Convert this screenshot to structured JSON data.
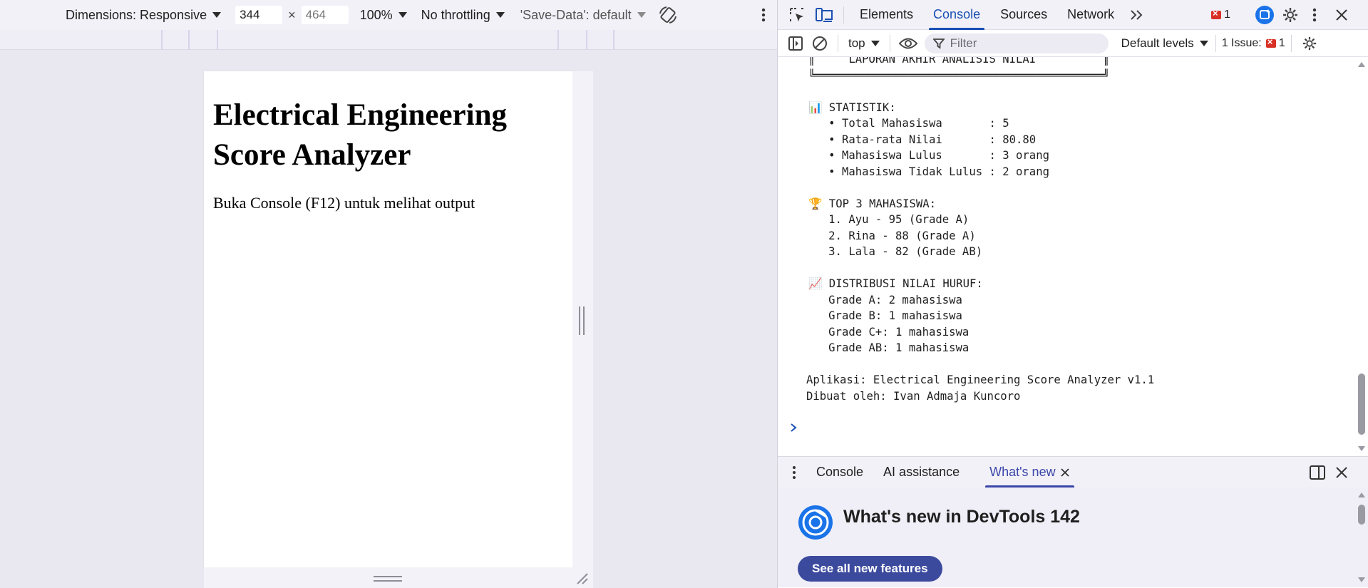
{
  "device_toolbar": {
    "dimensions_label": "Dimensions: Responsive",
    "width_value": "344",
    "height_placeholder": "464",
    "times": "×",
    "zoom": "100%",
    "throttling": "No throttling",
    "save_data": "'Save-Data': default"
  },
  "page": {
    "heading": "Electrical Engineering Score Analyzer",
    "text": "Buka Console (F12) untuk melihat output"
  },
  "devtools": {
    "tabs": [
      "Elements",
      "Console",
      "Sources",
      "Network"
    ],
    "active_tab": "Console",
    "error_count": "1",
    "console_toolbar": {
      "context": "top",
      "filter_placeholder": "Filter",
      "levels": "Default levels",
      "issues_label": "1 Issue:",
      "issues_count": "1"
    },
    "console_lines": [
      "║     LAPORAN AKHIR ANALISIS NILAI          ║",
      "╚═══════════════════════════════════════════╝",
      "",
      "📊 STATISTIK:",
      "   • Total Mahasiswa       : 5",
      "   • Rata-rata Nilai       : 80.80",
      "   • Mahasiswa Lulus       : 3 orang",
      "   • Mahasiswa Tidak Lulus : 2 orang",
      "",
      "🏆 TOP 3 MAHASISWA:",
      "   1. Ayu - 95 (Grade A)",
      "   2. Rina - 88 (Grade A)",
      "   3. Lala - 82 (Grade AB)",
      "",
      "📈 DISTRIBUSI NILAI HURUF:",
      "   Grade A: 2 mahasiswa",
      "   Grade B: 1 mahasiswa",
      "   Grade C+: 1 mahasiswa",
      "   Grade AB: 1 mahasiswa",
      "",
      "Aplikasi: Electrical Engineering Score Analyzer v1.1",
      "Dibuat oleh: Ivan Admaja Kuncoro"
    ],
    "drawer": {
      "tabs": [
        "Console",
        "AI assistance",
        "What's new"
      ],
      "active_tab": "What's new",
      "whats_new_title": "What's new in DevTools 142",
      "button_label": "See all new features"
    }
  },
  "colors": {
    "accent": "#1a4fb3",
    "drawer_accent": "#3b46a8",
    "button_bg": "#3c4a9e",
    "error_red": "#d93025"
  }
}
